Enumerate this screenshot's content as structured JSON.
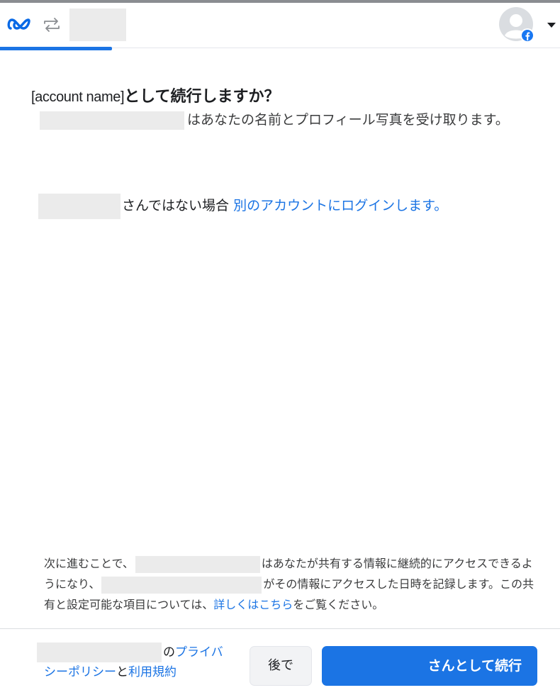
{
  "header": {
    "logo_icon": "meta-logo-icon",
    "switch_icon": "switch-arrows-icon",
    "avatar_icon": "default-avatar-icon",
    "badge_icon": "facebook-badge-icon",
    "menu_icon": "caret-down-icon"
  },
  "colors": {
    "accent": "#1b74e4",
    "text": "#1c1e21",
    "muted": "#3a3b3c",
    "placeholder": "#ebebeb"
  },
  "progress": {
    "value": 0.2
  },
  "main": {
    "title_account": "[account name]",
    "title_text": "として続行しますか？",
    "permission_text": "はあなたの名前とプロフィール写真を受け取ります。",
    "not_you_text": "さんではない場合 ",
    "switch_account_link": "別のアカウントにログインします。"
  },
  "footer": {
    "notice_part1": "次に進むことで、",
    "notice_part2": "はあなたが共有する情報に継続的にアクセスできるようになり、",
    "notice_part3": "がその情報にアクセスした日時を記録します。この共有と設定可能な項目については、",
    "learn_more_link": "詳しくはこちら",
    "notice_part4": "をご覧ください。",
    "policy_of": "の",
    "privacy_policy_link": "プライバシーポリシー",
    "and_text": "と",
    "terms_link": "利用規約",
    "later_button": "後で",
    "continue_button": "さんとして続行"
  }
}
